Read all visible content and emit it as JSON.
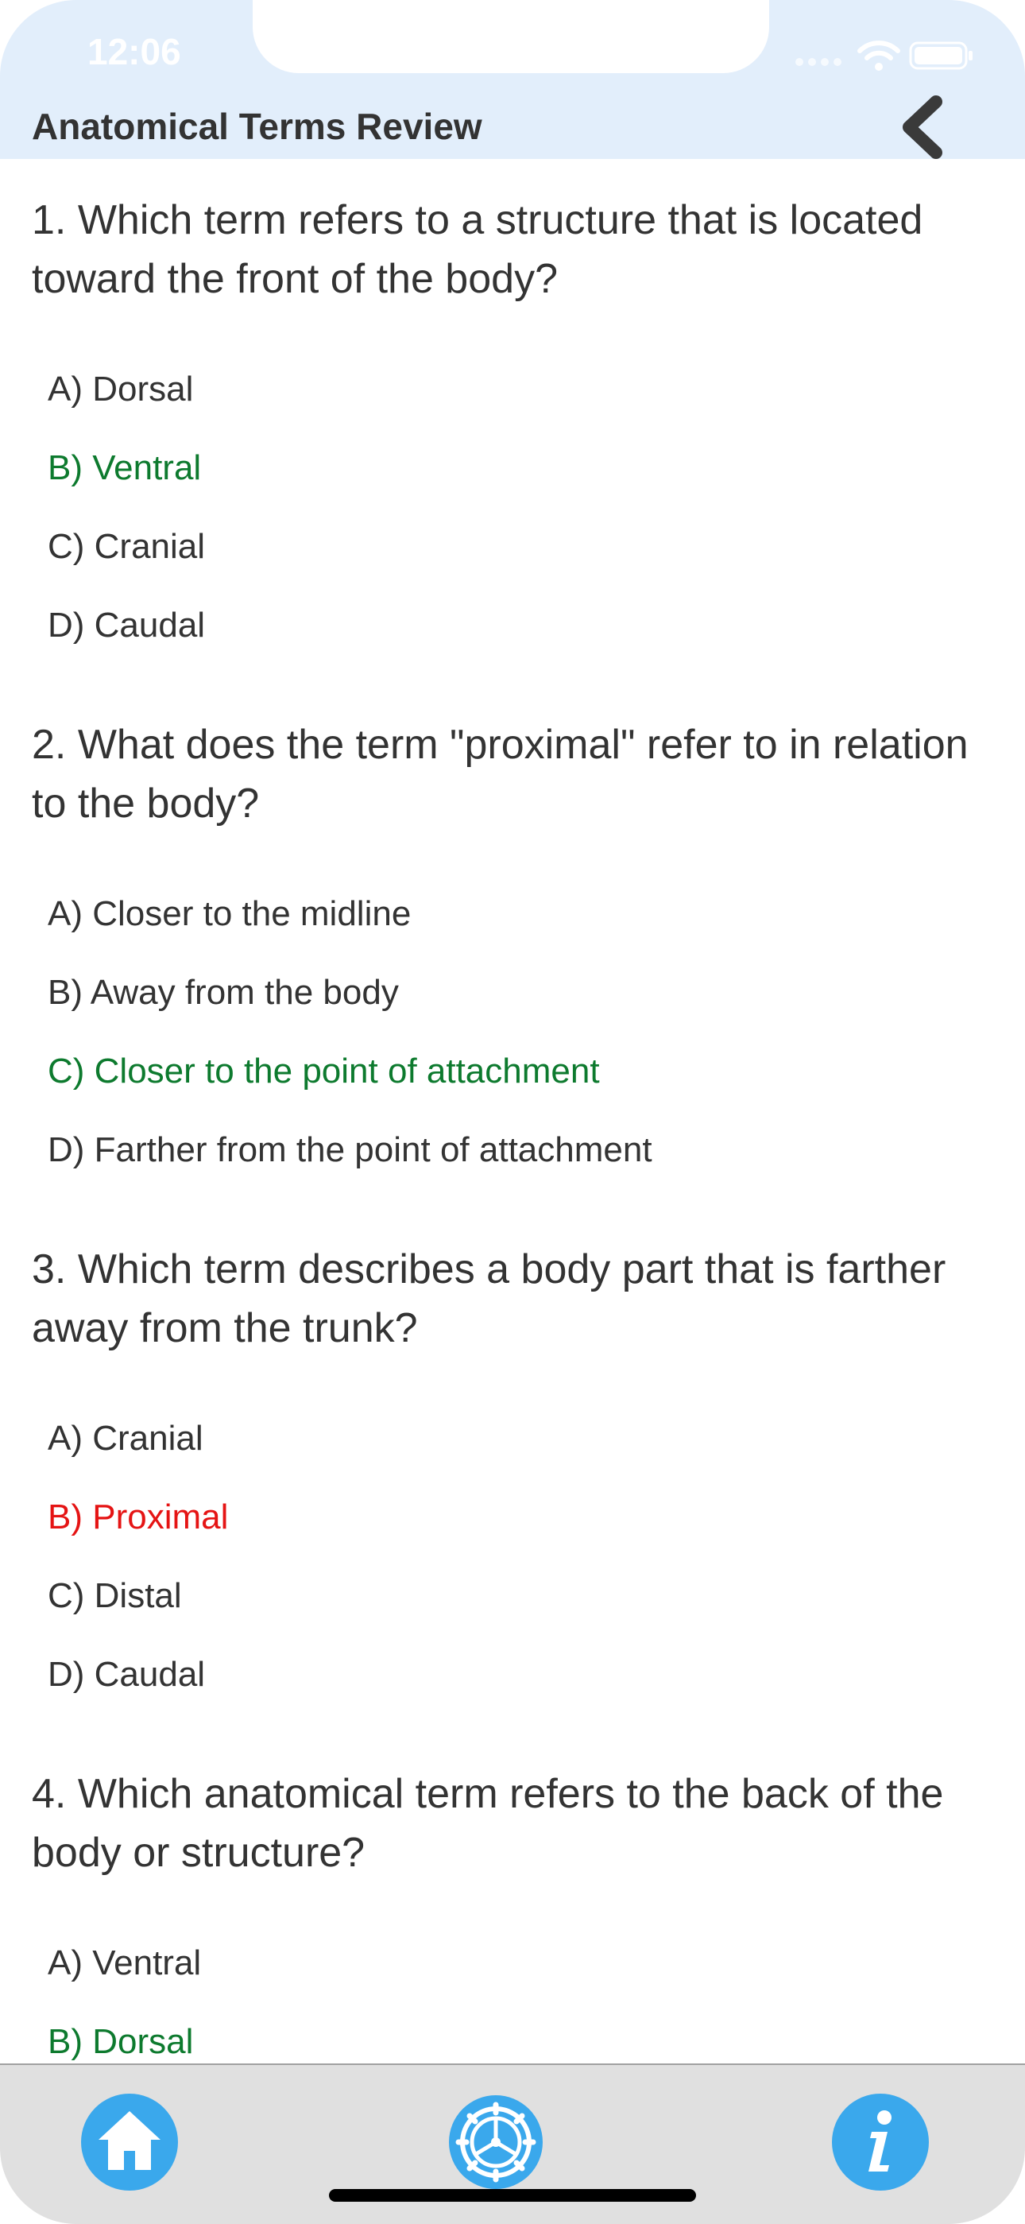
{
  "status_bar": {
    "time": "12:06"
  },
  "header": {
    "title": "Anatomical Terms Review"
  },
  "questions": [
    {
      "text": "1. Which term refers to a structure that is located toward the front of the body?",
      "answers": [
        "A) Dorsal",
        "B) Ventral",
        "C) Cranial",
        "D) Caudal"
      ],
      "answer_states": [
        "neutral",
        "correct",
        "neutral",
        "neutral"
      ]
    },
    {
      "text": "2. What does the term \"proximal\" refer to in relation to the body?",
      "answers": [
        "A) Closer to the midline",
        "B) Away from the body",
        "C) Closer to the point of attachment",
        "D) Farther from the point of attachment"
      ],
      "answer_states": [
        "neutral",
        "neutral",
        "correct",
        "neutral"
      ]
    },
    {
      "text": "3. Which term describes a body part that is farther away from the trunk?",
      "answers": [
        "A) Cranial",
        "B) Proximal",
        "C) Distal",
        "D) Caudal"
      ],
      "answer_states": [
        "neutral",
        "wrong",
        "neutral",
        "neutral"
      ]
    },
    {
      "text": "4. Which anatomical term refers to the back of the body or structure?",
      "answers": [
        "A) Ventral",
        "B) Dorsal"
      ],
      "answer_states": [
        "neutral",
        "correct"
      ]
    }
  ],
  "tabbar": {
    "items": [
      {
        "icon": "home-icon"
      },
      {
        "icon": "settings-wheel-icon"
      },
      {
        "icon": "info-icon"
      }
    ]
  },
  "colors": {
    "header_bg": "#e2eefb",
    "correct": "#0d7a2e",
    "wrong": "#e51414",
    "accent": "#3aa8ec",
    "tabbar_bg": "#e0e0e0"
  }
}
